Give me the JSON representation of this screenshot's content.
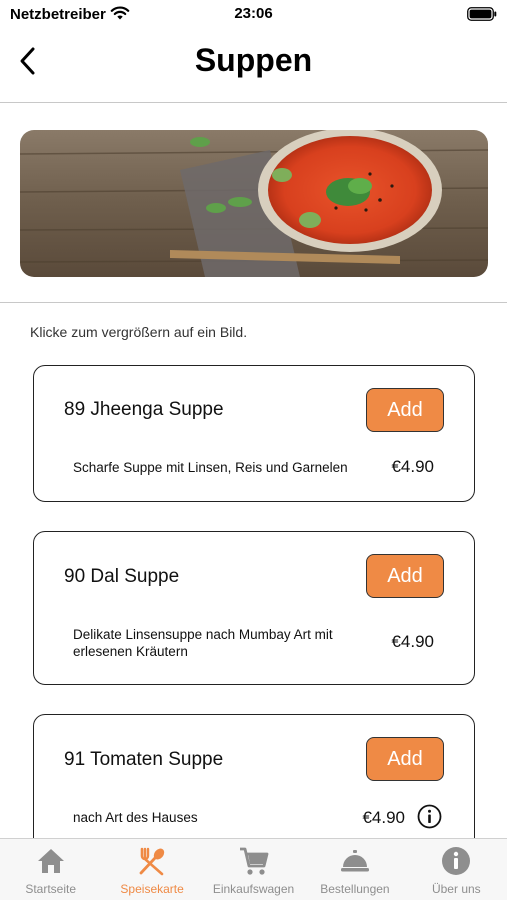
{
  "status": {
    "carrier": "Netzbetreiber",
    "time": "23:06"
  },
  "header": {
    "title": "Suppen"
  },
  "hint": "Klicke zum vergrößern auf ein Bild.",
  "items": [
    {
      "name": "89 Jheenga Suppe",
      "description": "Scharfe Suppe mit Linsen, Reis und Garnelen",
      "price": "€4.90",
      "add_label": "Add"
    },
    {
      "name": "90 Dal Suppe",
      "description": "Delikate Linsensuppe nach Mumbay Art mit erlesenen Kräutern",
      "price": "€4.90",
      "add_label": "Add"
    },
    {
      "name": "91 Tomaten Suppe",
      "description": "nach Art des Hauses",
      "price": "€4.90",
      "add_label": "Add"
    }
  ],
  "tabs": [
    {
      "label": "Startseite",
      "icon": "home-icon"
    },
    {
      "label": "Speisekarte",
      "icon": "fork-spoon-icon",
      "active": true
    },
    {
      "label": "Einkaufswagen",
      "icon": "cart-icon"
    },
    {
      "label": "Bestellungen",
      "icon": "cloche-icon"
    },
    {
      "label": "Über uns",
      "icon": "info-icon"
    }
  ],
  "colors": {
    "accent": "#ef8a45",
    "tab_inactive": "#8e8e8e"
  }
}
